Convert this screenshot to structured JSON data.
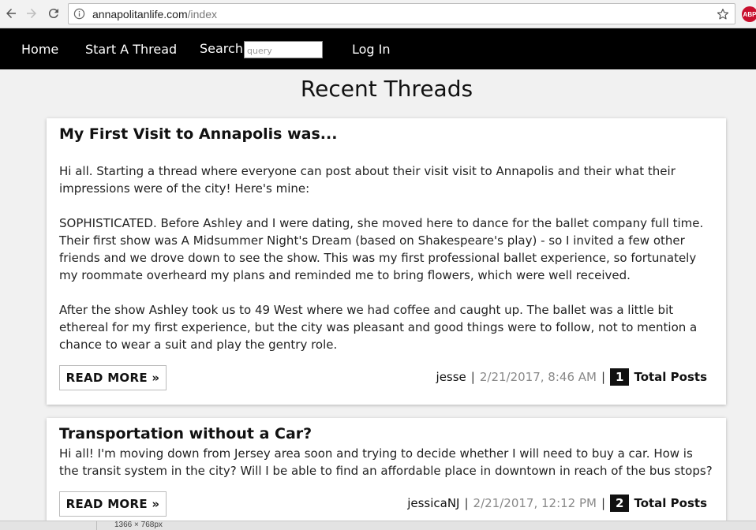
{
  "browser": {
    "url_host": "annapolitanlife.com",
    "url_path": "/index",
    "extension_label": "ABP"
  },
  "nav": {
    "home": "Home",
    "start_thread": "Start A Thread",
    "search_label": "Search",
    "search_placeholder": "query",
    "login": "Log In"
  },
  "page": {
    "title": "Recent Threads"
  },
  "threads": [
    {
      "title": "My First Visit to Annapolis was...",
      "paragraphs": [
        "Hi all. Starting a thread where everyone can post about their visit visit to Annapolis and their what their impressions were of the city! Here's mine:",
        "SOPHISTICATED. Before Ashley and I were dating, she moved here to dance for the ballet company full time. Their first show was A Midsummer Night's Dream (based on Shakespeare's play) - so I invited a few other friends and we drove down to see the show. This was my first professional ballet experience, so fortunately my roommate overheard my plans and reminded me to bring flowers, which were well received.",
        "After the show Ashley took us to 49 West where we had coffee and caught up. The ballet was a little bit ethereal for my first experience, but the city was pleasant and good things were to follow, not to mention a chance to wear a suit and play the gentry role."
      ],
      "read_more": "READ MORE »",
      "author": "jesse",
      "date": "2/21/2017, 8:46 AM",
      "post_count": "1",
      "total_label": "Total Posts"
    },
    {
      "title": "Transportation without a Car?",
      "paragraphs": [
        "Hi all! I'm moving down from Jersey area soon and trying to decide whether I will need to buy a car. How is the transit system in the city? Will I be able to find an affordable place in downtown in reach of the bus stops?"
      ],
      "read_more": "READ MORE »",
      "author": "jessicaNJ",
      "date": "2/21/2017, 12:12 PM",
      "post_count": "2",
      "total_label": "Total Posts"
    }
  ],
  "statusbar": {
    "tooltip": "1366 × 768px"
  },
  "colors": {
    "navbar_bg": "#000000",
    "page_bg": "#f1f1f1",
    "card_bg": "#ffffff",
    "badge_bg": "#111111",
    "date_text": "#888888"
  }
}
